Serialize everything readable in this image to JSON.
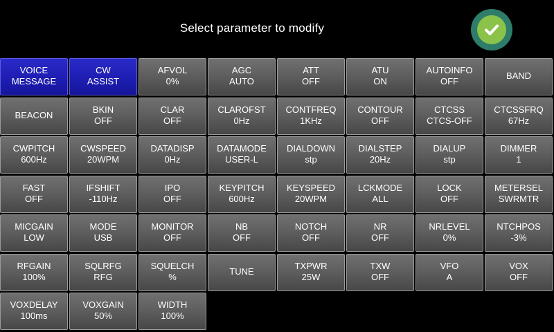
{
  "header": {
    "title": "Select parameter to modify",
    "ok_icon": "checkmark-icon",
    "ok_color": "#8bc34a"
  },
  "params": [
    {
      "name": "VOICE",
      "value": "MESSAGE",
      "active": true
    },
    {
      "name": "CW",
      "value": "ASSIST",
      "active": true
    },
    {
      "name": "AFVOL",
      "value": "0%"
    },
    {
      "name": "AGC",
      "value": "AUTO"
    },
    {
      "name": "ATT",
      "value": "OFF"
    },
    {
      "name": "ATU",
      "value": "ON"
    },
    {
      "name": "AUTOINFO",
      "value": "OFF"
    },
    {
      "name": "BAND",
      "value": ""
    },
    {
      "name": "BEACON",
      "value": ""
    },
    {
      "name": "BKIN",
      "value": "OFF"
    },
    {
      "name": "CLAR",
      "value": "OFF"
    },
    {
      "name": "CLAROFST",
      "value": "0Hz"
    },
    {
      "name": "CONTFREQ",
      "value": "1KHz"
    },
    {
      "name": "CONTOUR",
      "value": "OFF"
    },
    {
      "name": "CTCSS",
      "value": "CTCS-OFF"
    },
    {
      "name": "CTCSSFRQ",
      "value": "67Hz"
    },
    {
      "name": "CWPITCH",
      "value": "600Hz"
    },
    {
      "name": "CWSPEED",
      "value": "20WPM"
    },
    {
      "name": "DATADISP",
      "value": "0Hz"
    },
    {
      "name": "DATAMODE",
      "value": "USER-L"
    },
    {
      "name": "DIALDOWN",
      "value": "stp"
    },
    {
      "name": "DIALSTEP",
      "value": "20Hz"
    },
    {
      "name": "DIALUP",
      "value": "stp"
    },
    {
      "name": "DIMMER",
      "value": "1"
    },
    {
      "name": "FAST",
      "value": "OFF"
    },
    {
      "name": "IFSHIFT",
      "value": "-110Hz"
    },
    {
      "name": "IPO",
      "value": "OFF"
    },
    {
      "name": "KEYPITCH",
      "value": "600Hz"
    },
    {
      "name": "KEYSPEED",
      "value": "20WPM"
    },
    {
      "name": "LCKMODE",
      "value": "ALL"
    },
    {
      "name": "LOCK",
      "value": "OFF"
    },
    {
      "name": "METERSEL",
      "value": "SWRMTR"
    },
    {
      "name": "MICGAIN",
      "value": "LOW"
    },
    {
      "name": "MODE",
      "value": "USB"
    },
    {
      "name": "MONITOR",
      "value": "OFF"
    },
    {
      "name": "NB",
      "value": "OFF"
    },
    {
      "name": "NOTCH",
      "value": "OFF"
    },
    {
      "name": "NR",
      "value": "OFF"
    },
    {
      "name": "NRLEVEL",
      "value": "0%"
    },
    {
      "name": "NTCHPOS",
      "value": "-3%"
    },
    {
      "name": "RFGAIN",
      "value": "100%"
    },
    {
      "name": "SQLRFG",
      "value": "RFG"
    },
    {
      "name": "SQUELCH",
      "value": "%"
    },
    {
      "name": "TUNE",
      "value": ""
    },
    {
      "name": "TXPWR",
      "value": "25W"
    },
    {
      "name": "TXW",
      "value": "OFF"
    },
    {
      "name": "VFO",
      "value": "A"
    },
    {
      "name": "VOX",
      "value": "OFF"
    },
    {
      "name": "VOXDELAY",
      "value": "100ms"
    },
    {
      "name": "VOXGAIN",
      "value": "50%"
    },
    {
      "name": "WIDTH",
      "value": "100%"
    }
  ]
}
